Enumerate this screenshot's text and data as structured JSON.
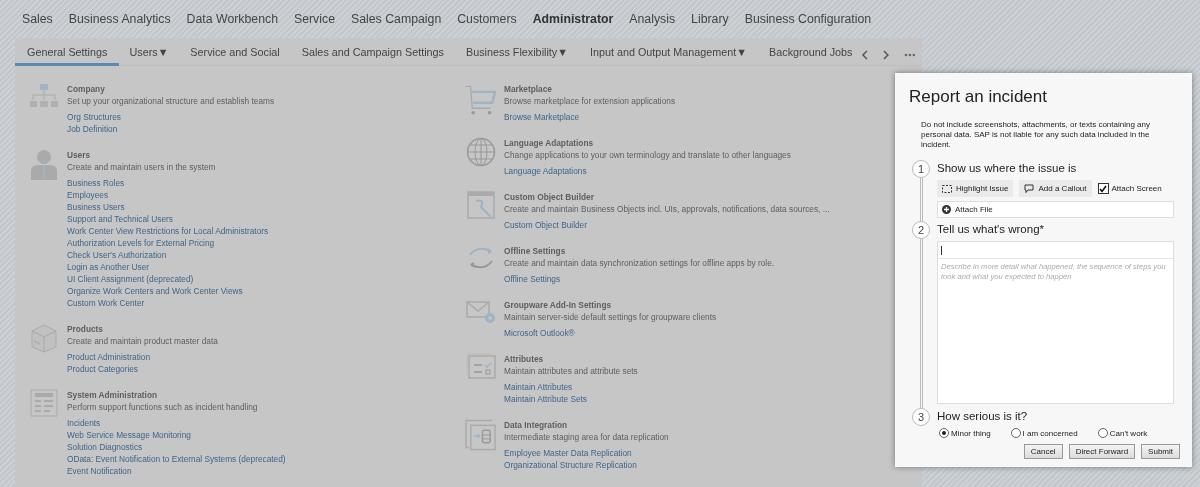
{
  "nav": [
    {
      "label": "Sales",
      "selected": false
    },
    {
      "label": "Business Analytics",
      "selected": false
    },
    {
      "label": "Data Workbench",
      "selected": false
    },
    {
      "label": "Service",
      "selected": false
    },
    {
      "label": "Sales Campaign",
      "selected": false
    },
    {
      "label": "Customers",
      "selected": false
    },
    {
      "label": "Administrator",
      "selected": true
    },
    {
      "label": "Analysis",
      "selected": false
    },
    {
      "label": "Library",
      "selected": false
    },
    {
      "label": "Business Configuration",
      "selected": false
    }
  ],
  "tabs": [
    {
      "label": "General Settings",
      "selected": true
    },
    {
      "label": "Users▼",
      "selected": false
    },
    {
      "label": "Service and Social",
      "selected": false
    },
    {
      "label": "Sales and Campaign Settings",
      "selected": false
    },
    {
      "label": "Business Flexibility▼",
      "selected": false
    },
    {
      "label": "Input and Output Management▼",
      "selected": false
    },
    {
      "label": "Background Jobs",
      "selected": false
    }
  ],
  "columns": [
    [
      {
        "kind": "org",
        "title": "Company",
        "description": "Set up your organizational structure and establish teams",
        "links": [
          "Org Structures",
          "Job Definition"
        ]
      },
      {
        "kind": "user",
        "title": "Users",
        "description": "Create and maintain users in the system",
        "links": [
          "Business Roles",
          "Employees",
          "Business Users",
          "Support and Technical Users",
          "Work Center View Restrictions for Local Administrators",
          "Authorization Levels for External Pricing",
          "Check User's Authorization",
          "Login as Another User",
          "UI Client Assignment (deprecated)",
          "Organize Work Centers and Work Center Views",
          "Custom Work Center"
        ]
      },
      {
        "kind": "product",
        "title": "Products",
        "description": "Create and maintain product master data",
        "links": [
          "Product Administration",
          "Product Categories"
        ]
      },
      {
        "kind": "sysadmin",
        "title": "System Administration",
        "description": "Perform support functions such as incident handling",
        "links": [
          "Incidents",
          "Web Service Message Monitoring",
          "Solution Diagnostics",
          "OData: Event Notification to External Systems (deprecated)",
          "Event Notification"
        ]
      }
    ],
    [
      {
        "kind": "cart",
        "title": "Marketplace",
        "description": "Browse marketplace for extension applications",
        "links": [
          "Browse Marketplace"
        ]
      },
      {
        "kind": "globe",
        "title": "Language Adaptations",
        "description": "Change applications to your own terminology and translate to other languages",
        "links": [
          "Language Adaptations"
        ]
      },
      {
        "kind": "builder",
        "title": "Custom Object Builder",
        "description": "Create and maintain Business Objects incl. UIs, approvals, notifications, data sources, ...",
        "links": [
          "Custom Object Builder"
        ]
      },
      {
        "kind": "sync",
        "title": "Offline Settings",
        "description": "Create and maintain data synchronization settings for offline apps by role.",
        "links": [
          "Offline Settings"
        ]
      },
      {
        "kind": "mail",
        "title": "Groupware Add-In Settings",
        "description": "Maintain server-side default settings for groupware clients",
        "links": [
          "Microsoft Outlook®"
        ]
      },
      {
        "kind": "attributes",
        "title": "Attributes",
        "description": "Maintain attributes and attribute sets",
        "links": [
          "Maintain Attributes",
          "Maintain Attribute Sets"
        ]
      },
      {
        "kind": "data",
        "title": "Data Integration",
        "description": "Intermediate staging area for data replication",
        "links": [
          "Employee Master Data Replication",
          "Organizational Structure Replication"
        ]
      }
    ]
  ],
  "dialog": {
    "title": "Report an incident",
    "notice": "Do not include screenshots, attachments, or texts containing any personal data. SAP is not liable for any such data included in the incident.",
    "step1": {
      "number": "1",
      "heading": "Show us where the issue is",
      "highlight": "Highlight Issue",
      "callout": "Add a Callout",
      "attach_screen": {
        "label": "Attach Screen",
        "checked": true
      },
      "attach_file": "Attach File"
    },
    "step2": {
      "number": "2",
      "heading": "Tell us what's wrong*",
      "placeholder": "Describe in more detail what happened, the sequence of steps you took and what you expected to happen"
    },
    "step3": {
      "number": "3",
      "heading": "How serious is it?",
      "options": [
        {
          "label": "Minor thing",
          "selected": true
        },
        {
          "label": "I am concerned",
          "selected": false
        },
        {
          "label": "Can't work",
          "selected": false
        }
      ]
    },
    "buttons": [
      "Cancel",
      "Direct Forward",
      "Submit"
    ]
  }
}
